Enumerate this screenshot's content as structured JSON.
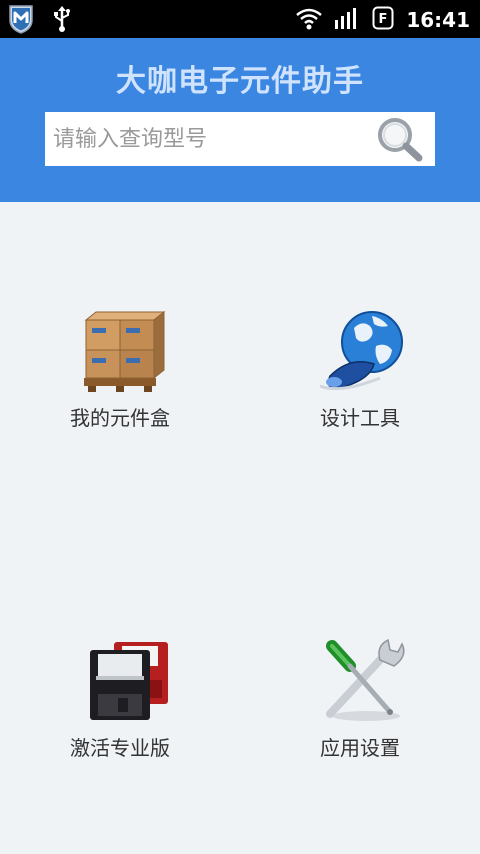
{
  "status_bar": {
    "time": "16:41",
    "icons": [
      "mcafee-shield-icon",
      "usb-icon",
      "wifi-icon",
      "signal-icon",
      "flashlight-icon"
    ]
  },
  "header": {
    "title": "大咖电子元件助手"
  },
  "search": {
    "placeholder": "请输入查询型号",
    "icon": "search-icon"
  },
  "menu": [
    {
      "label": "我的元件盒",
      "icon": "boxes-pallet-icon"
    },
    {
      "label": "设计工具",
      "icon": "globe-mouse-icon"
    },
    {
      "label": "激活专业版",
      "icon": "floppy-disk-icon"
    },
    {
      "label": "应用设置",
      "icon": "tools-icon"
    }
  ],
  "colors": {
    "header_bg": "#3a86e0",
    "status_bg": "#000000",
    "page_bg": "#f0f3f6"
  }
}
